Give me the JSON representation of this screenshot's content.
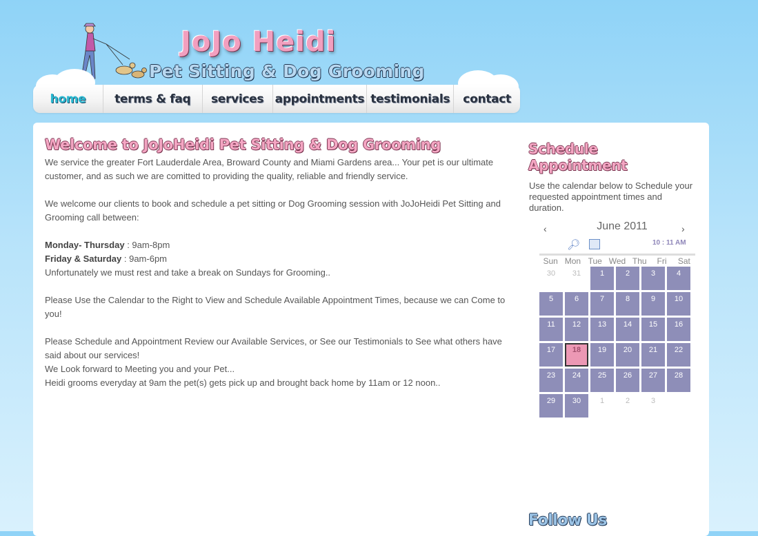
{
  "logo": {
    "title": "JoJo Heidi",
    "subtitle": "Pet Sitting & Dog Grooming"
  },
  "nav": [
    {
      "label": "home",
      "active": true
    },
    {
      "label": "terms & faq"
    },
    {
      "label": "services"
    },
    {
      "label": "appointments"
    },
    {
      "label": "testimonials"
    },
    {
      "label": "contact"
    }
  ],
  "main": {
    "heading": "Welcome to JoJoHeidi Pet Sitting & Dog Grooming",
    "p1": "We service the greater Fort Lauderdale Area, Broward County and Miami Gardens area... Your pet is our ultimate customer, and as such we are comitted to providing the quality, reliable and friendly service.",
    "p2": "We welcome our clients to book and schedule a pet sitting or Dog Grooming session with JoJoHeidi Pet Sitting and Grooming call between:",
    "hours1_label": "Monday- Thursday",
    "hours1_value": " : 9am-8pm",
    "hours2_label": "Friday & Saturday",
    "hours2_value": " : 9am-6pm",
    "sunday_note": "Unfortunately we must rest and take a break on Sundays for Grooming..",
    "p4": "Please Use the Calendar to the Right to View and Schedule Available Appointment Times, because we can Come to you!",
    "p5": "Please Schedule and Appointment Review our Available Services, or See our Testimonials to See what others have said about our services!",
    "p6": "We Look forward to Meeting you and your Pet...",
    "p7": "Heidi grooms everyday at 9am the pet(s) gets pick up and brought back home by 11am or 12 noon.."
  },
  "sidebar": {
    "heading": "Schedule Appointment",
    "desc": "Use the calendar below to Schedule your requested appointment times and duration.",
    "follow": "Follow Us"
  },
  "calendar": {
    "month": "June 2011",
    "prev": "‹",
    "next": "›",
    "time": "10 : 11 AM",
    "weekdays": [
      "Sun",
      "Mon",
      "Tue",
      "Wed",
      "Thu",
      "Fri",
      "Sat"
    ],
    "today": "18",
    "days": [
      "30",
      "31",
      "1",
      "2",
      "3",
      "4",
      "5",
      "6",
      "7",
      "8",
      "9",
      "10",
      "11",
      "12",
      "13",
      "14",
      "15",
      "16",
      "17",
      "18",
      "19",
      "20",
      "21",
      "22",
      "23",
      "24",
      "25",
      "26",
      "27",
      "28",
      "29",
      "30",
      "1",
      "2",
      "3"
    ],
    "muted_index": [
      0,
      1,
      32,
      33,
      34
    ],
    "today_index": 19,
    "colors": {
      "day": "#8e8eb8",
      "today": "#ec98b4"
    }
  }
}
